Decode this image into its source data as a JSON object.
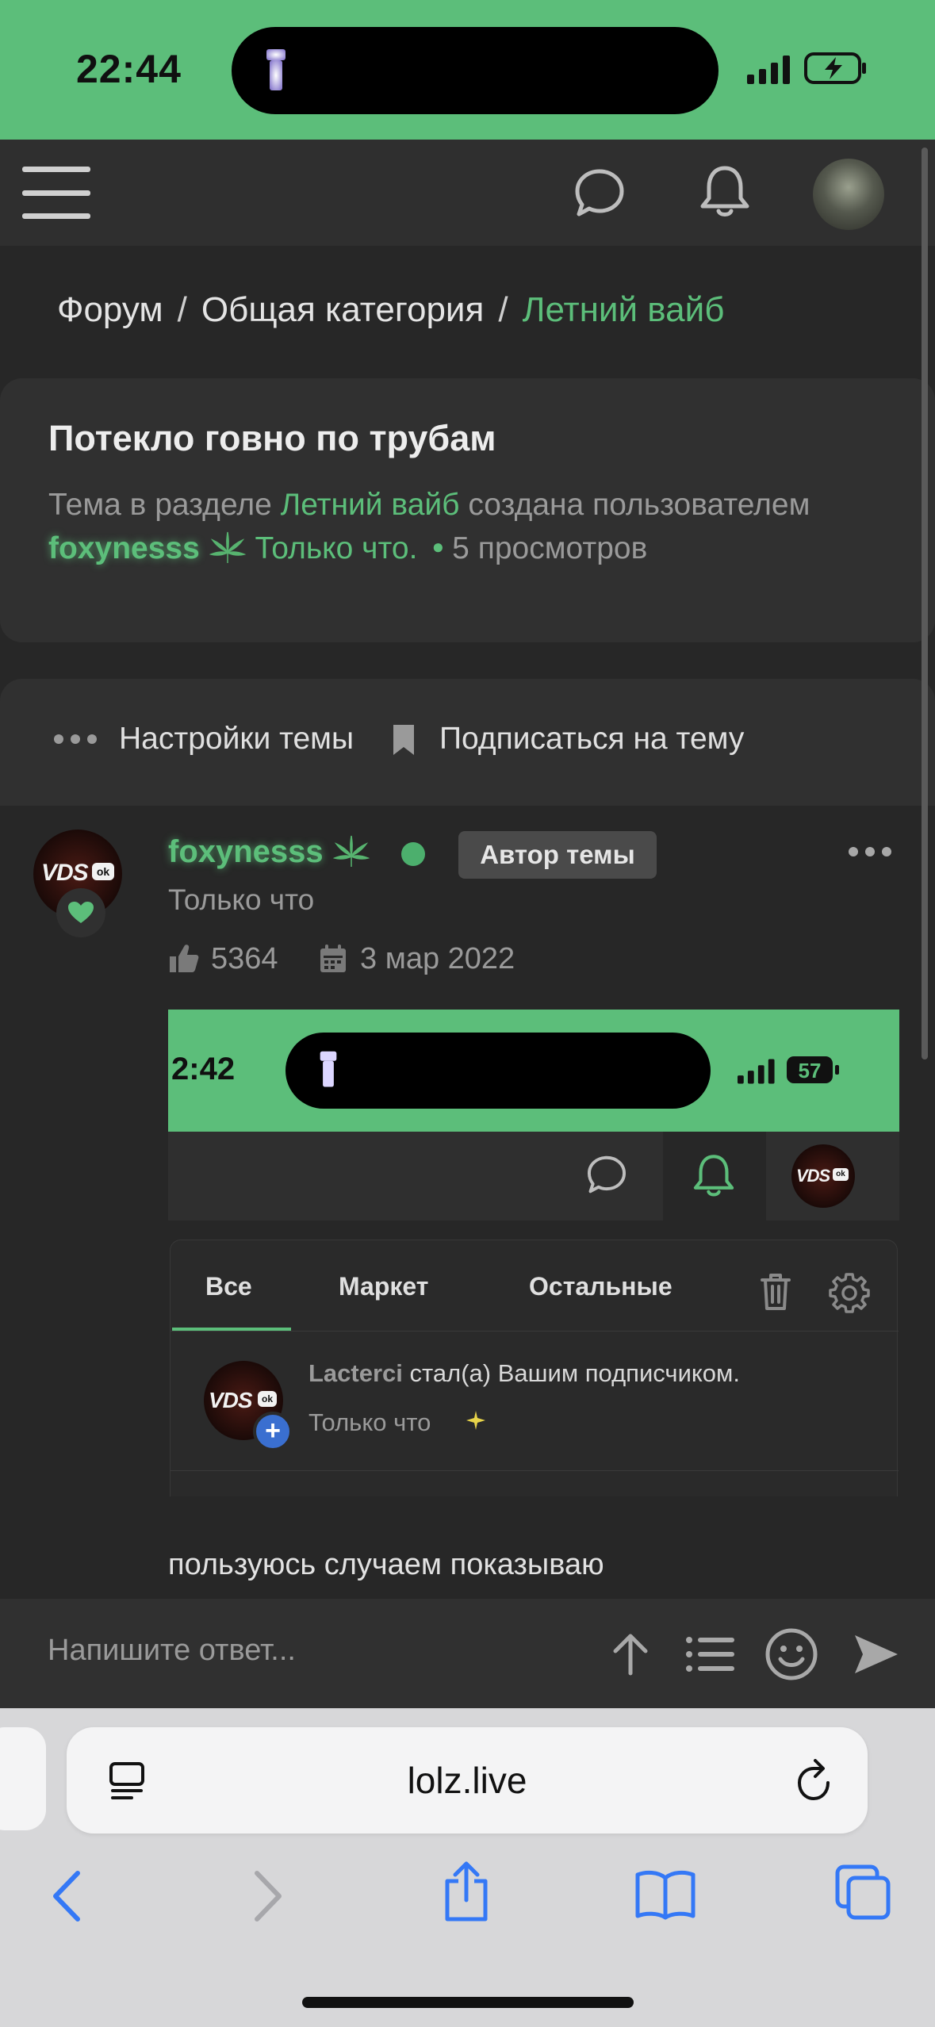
{
  "status_bar": {
    "time": "22:44"
  },
  "breadcrumb": {
    "items": [
      "Форум",
      "Общая категория",
      "Летний вайб"
    ],
    "separator": "/"
  },
  "thread": {
    "title": "Потекло говно по трубам",
    "meta_prefix": "Тема в разделе",
    "section": "Летний вайб",
    "meta_created": "создана пользователем",
    "author": "foxynesss",
    "created_time": "Только что.",
    "views_count": "5",
    "views_label": "просмотров"
  },
  "actions": {
    "settings_label": "Настройки темы",
    "subscribe_label": "Подписаться на тему"
  },
  "post": {
    "author": "foxynesss",
    "author_badge": "Автор темы",
    "time": "Только что",
    "likes": "5364",
    "reg_date": "3 мар 2022",
    "avatar_text": "VDS",
    "avatar_badge": "ok",
    "text": "пользуюсь случаем показываю"
  },
  "embedded_screenshot": {
    "time": "2:42",
    "battery": "57",
    "tabs": [
      "Все",
      "Маркет",
      "Остальные"
    ],
    "notification": {
      "user": "Lacterci",
      "text": "стал(а) Вашим подписчиком.",
      "time": "Только что"
    }
  },
  "reply": {
    "placeholder": "Напишите ответ..."
  },
  "browser": {
    "url": "lolz.live"
  },
  "colors": {
    "accent": "#5cbe7a",
    "background": "#272727",
    "card": "#303030",
    "link_blue": "#3478f6"
  },
  "icons": [
    "menu-icon",
    "chat-icon",
    "bell-icon",
    "cannabis-leaf-icon",
    "bookmark-icon",
    "heart-icon",
    "like-icon",
    "calendar-icon",
    "trash-icon",
    "gear-icon",
    "upload-icon",
    "list-icon",
    "smile-icon",
    "send-icon",
    "reader-icon",
    "reload-icon",
    "back-icon",
    "forward-icon",
    "share-icon",
    "bookmarks-icon",
    "tabs-icon"
  ]
}
